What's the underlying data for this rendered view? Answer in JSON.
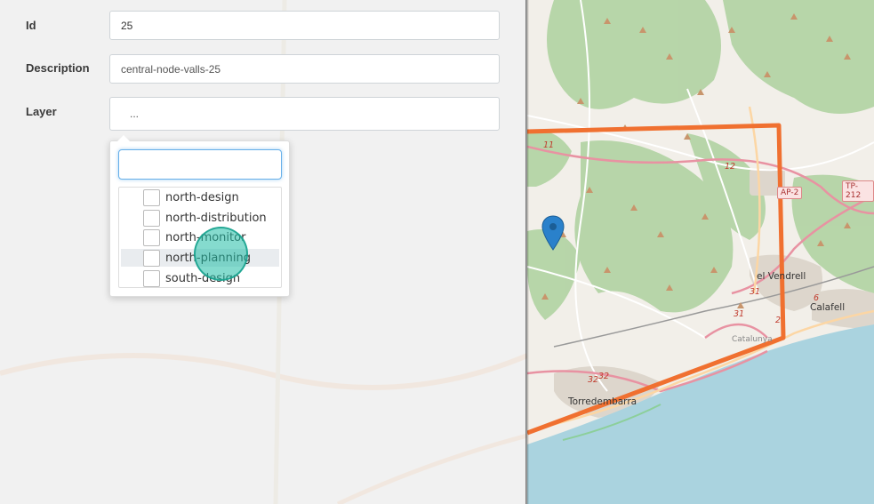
{
  "form": {
    "id_label": "Id",
    "id_value": "25",
    "description_label": "Description",
    "description_value": "central-node-valls-25",
    "layer_label": "Layer",
    "layer_value": "..."
  },
  "layer_dropdown": {
    "search_value": "",
    "options": [
      {
        "label": "north-design",
        "checked": false
      },
      {
        "label": "north-distribution",
        "checked": false
      },
      {
        "label": "north-monitor",
        "checked": false
      },
      {
        "label": "north-planning",
        "checked": false
      },
      {
        "label": "south-design",
        "checked": false
      }
    ],
    "hovered_option": "north-planning"
  },
  "map": {
    "places": [
      "el Vendrell",
      "Calafell",
      "Torredembarra",
      "Catalunya"
    ],
    "road_numbers": [
      "11",
      "12",
      "31",
      "31",
      "32",
      "32",
      "6",
      "2"
    ],
    "road_shields": [
      "AP-2",
      "TP-212"
    ],
    "colors": {
      "boundary": "#f07030",
      "sea": "#aad3df",
      "forest": "#add19e",
      "marker": "#2a81cb"
    },
    "marker_icon": "map-pin-icon"
  }
}
